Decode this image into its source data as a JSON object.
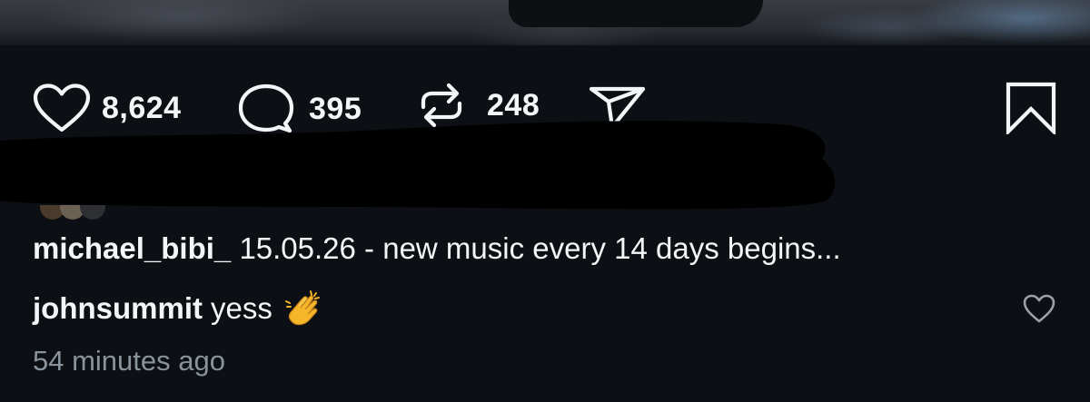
{
  "post": {
    "likes_count": "8,624",
    "comments_count": "395",
    "reposts_count": "248",
    "icons": {
      "like": "heart-outline-icon",
      "comment": "speech-bubble-icon",
      "repost": "repost-arrows-icon",
      "share": "paper-plane-icon",
      "save": "bookmark-outline-icon"
    }
  },
  "caption": {
    "username": "michael_bibi_",
    "text": "15.05.26 - new music every 14 days begins..."
  },
  "comment": {
    "username": "johnsummit",
    "text": "yess",
    "emoji": "clapping-hands-emoji",
    "time": "54 minutes ago"
  },
  "colors": {
    "background": "#0c0f14",
    "text": "#f3f5f7",
    "muted": "#8a929c"
  }
}
